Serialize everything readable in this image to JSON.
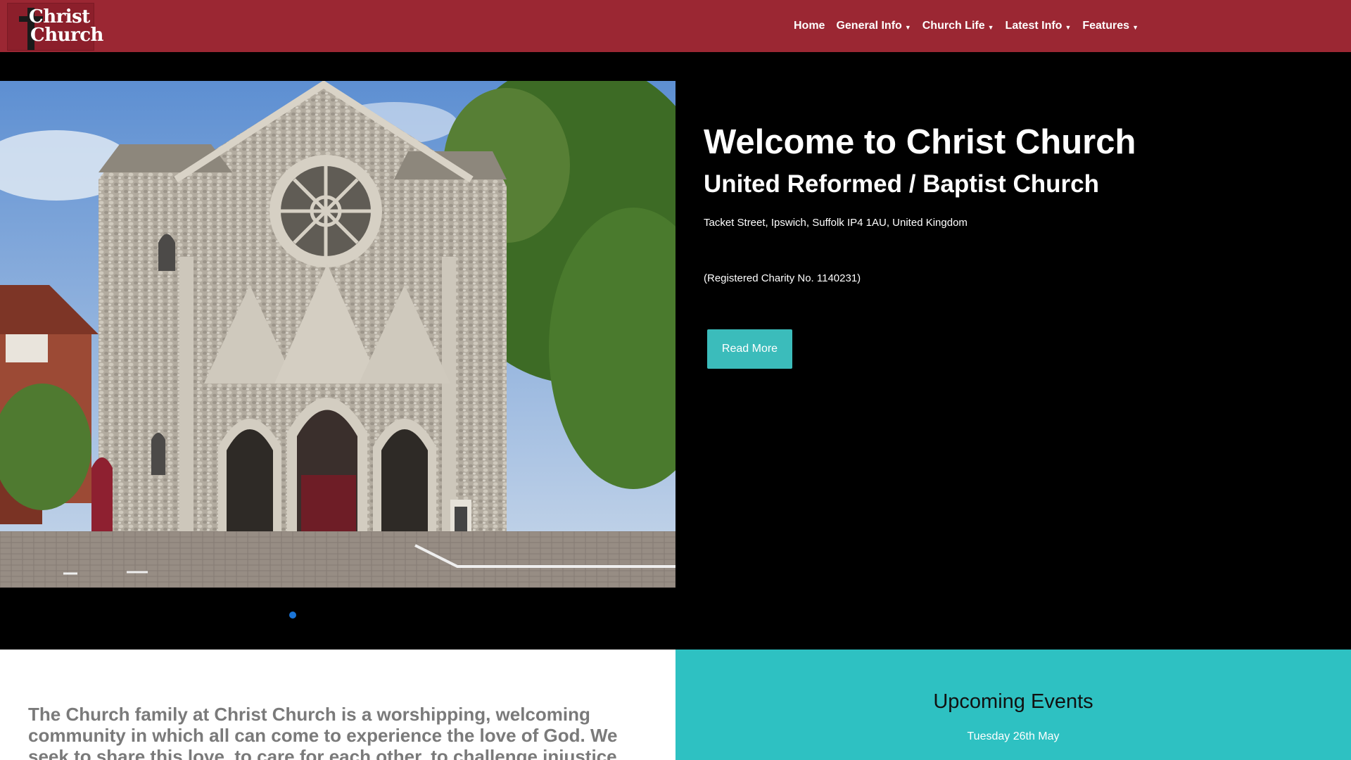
{
  "header": {
    "logo_line1": "Christ",
    "logo_line2": "Church",
    "nav": [
      {
        "label": "Home",
        "has_dropdown": false
      },
      {
        "label": "General Info",
        "has_dropdown": true
      },
      {
        "label": "Church Life",
        "has_dropdown": true
      },
      {
        "label": "Latest Info",
        "has_dropdown": true
      },
      {
        "label": "Features",
        "has_dropdown": true
      }
    ],
    "dropdown_caret": "▼"
  },
  "hero": {
    "title": "Welcome to Christ Church",
    "subtitle": "United Reformed / Baptist Church",
    "address": "Tacket Street, Ipswich, Suffolk IP4 1AU, United Kingdom",
    "charity": "(Registered Charity No. 1140231)",
    "button_label": "Read More",
    "image_icon": "church-photo"
  },
  "about": {
    "text": "The Church family at Christ Church is a worshipping, welcoming community in which all can come to experience the love of God.  We seek to share this love, to care for each other, to challenge injustice and"
  },
  "events": {
    "heading": "Upcoming Events",
    "date": "Tuesday 26th May"
  },
  "colors": {
    "header_bg": "#9b2733",
    "accent_teal": "#2ec1c2",
    "button_teal": "#3bbcbb",
    "slider_dot": "#1a75d8"
  }
}
